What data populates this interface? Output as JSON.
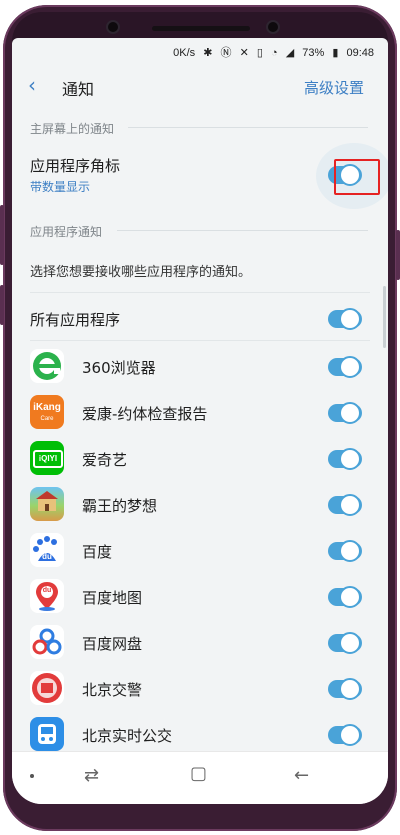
{
  "status_bar": {
    "speed": "0K/s",
    "icons": [
      "bluetooth-icon",
      "nfc-icon",
      "silent-icon",
      "sim-icon",
      "wifi-icon",
      "signal-icon"
    ],
    "battery": "73%",
    "time": "09:48"
  },
  "header": {
    "back_icon": "back-arrow-icon",
    "title": "通知",
    "advanced_label": "高级设置"
  },
  "home_section": {
    "heading": "主屏幕上的通知",
    "badge_title": "应用程序角标",
    "badge_subtitle": "带数量显示",
    "badge_enabled": true
  },
  "app_section": {
    "heading": "应用程序通知",
    "description": "选择您想要接收哪些应用程序的通知。",
    "all_apps_label": "所有应用程序",
    "all_apps_enabled": true,
    "apps": [
      {
        "name": "360浏览器",
        "icon": "browser-360-icon",
        "enabled": true
      },
      {
        "name": "爱康-约体检查报告",
        "icon": "ikang-icon",
        "icon_text": "iKang",
        "icon_sub": "Care",
        "enabled": true
      },
      {
        "name": "爱奇艺",
        "icon": "iqiyi-icon",
        "icon_text": "iQIYI",
        "enabled": true
      },
      {
        "name": "霸王的梦想",
        "icon": "game-icon",
        "enabled": true
      },
      {
        "name": "百度",
        "icon": "baidu-icon",
        "icon_text": "du",
        "enabled": true
      },
      {
        "name": "百度地图",
        "icon": "baidu-map-icon",
        "icon_text": "du",
        "enabled": true
      },
      {
        "name": "百度网盘",
        "icon": "baidu-netdisk-icon",
        "enabled": true
      },
      {
        "name": "北京交警",
        "icon": "beijing-police-icon",
        "enabled": true
      },
      {
        "name": "北京实时公交",
        "icon": "bus-icon",
        "enabled": true
      }
    ]
  },
  "colors": {
    "accent": "#3d7fc4",
    "toggle_on": "#4aa3d8",
    "highlight": "#e52222",
    "phone_frame": "#3a1d33"
  }
}
